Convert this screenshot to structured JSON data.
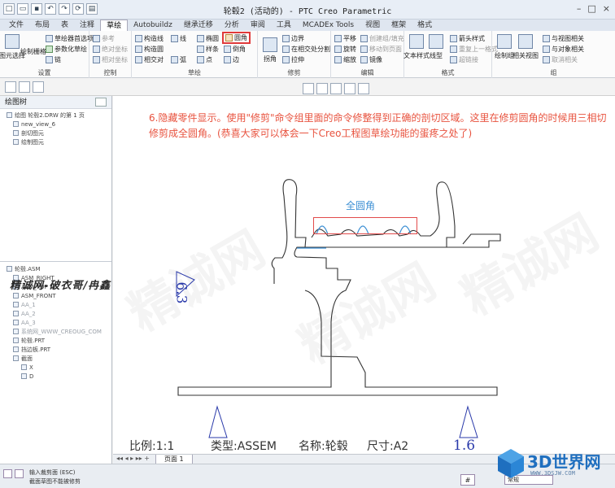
{
  "window": {
    "title": "轮毂2 (活动的) - PTC Creo Parametric"
  },
  "tabs": [
    "文件",
    "布局",
    "表",
    "注释",
    "草绘",
    "Autobuildz",
    "继承迁移",
    "分析",
    "审阅",
    "工具",
    "MCADEx Tools",
    "视图",
    "框架",
    "格式"
  ],
  "active_tab": "草绘",
  "ribbon": {
    "settings": {
      "select": "图元选择",
      "sketch": "绘制栅格",
      "options": [
        "草绘器首选项",
        "参数化草绘",
        "链"
      ],
      "label": "设置"
    },
    "control": {
      "items": [
        "参考",
        "绝对坐标",
        "相对坐标"
      ],
      "label": "控制"
    },
    "sketch": {
      "items": [
        "构造线",
        "构造圆",
        "相交对",
        "线",
        "椭圆",
        "样条",
        "弧",
        "圆角",
        "倒角",
        "边",
        "点"
      ],
      "label": "草绘"
    },
    "trim": {
      "items": [
        "边界",
        "在相交处分割",
        "拉伸",
        "拐角"
      ],
      "label": "修剪"
    },
    "edit": {
      "items": [
        "平移",
        "旋转",
        "缩放",
        "创建组/填充",
        "移动到页面",
        "镜像"
      ],
      "label": "编辑"
    },
    "format": {
      "items": [
        "文本样式",
        "线型",
        "箭头样式",
        "重复上一格式",
        "超链接"
      ],
      "label": "格式"
    },
    "group": {
      "items": [
        "绘制组",
        "相关视图",
        "与视图相关",
        "与对象相关",
        "取消相关"
      ],
      "label": "组"
    }
  },
  "left_panel": {
    "title": "绘图树",
    "tree_top": [
      "绘图 轮毂2.DRW 的第 1 页",
      "new_view_6",
      "剖切图元",
      "绘制图元"
    ],
    "watermark": "精诚网-破衣哥/冉鑫",
    "model_tree": [
      "轮毂.ASM",
      "ASM_RIGHT",
      "ASM_TOP",
      "ASM_FRONT",
      "AA_1",
      "AA_2",
      "AA_3",
      "系统网_WWW_CREOUG_COM",
      "轮毂.PRT",
      "挡边板.PRT",
      "截面",
      "X",
      "D"
    ]
  },
  "canvas": {
    "instruction": "6.隐藏零件显示。使用\"修剪\"命令组里面的命令修整得到正确的剖切区域。这里在修剪圆角的时候用三相切修剪成全圆角。(恭喜大家可以体会一下Creo工程图草绘功能的蛋疼之处了)",
    "callout": "全圆角",
    "scale_left": "6.3",
    "scale_bottom": "1.6",
    "footer": {
      "scale": "比例:1:1",
      "type": "类型:ASSEM",
      "name": "名称:轮毂",
      "size": "尺寸:A2"
    },
    "bg_watermark": "精诚网"
  },
  "sheetbar": {
    "sheet": "页面 1"
  },
  "status": {
    "line1": "输入裁剪面 (ESC)",
    "line2": "截面草图不能被修剪",
    "filter": "常规",
    "button": "#"
  },
  "logo": {
    "name": "3D世界网",
    "url": "WWW.3DSJW.COM"
  },
  "colors": {
    "instruction": "#e8533f",
    "callout": "#3c8fd4",
    "highlight": "#e03a3a"
  }
}
